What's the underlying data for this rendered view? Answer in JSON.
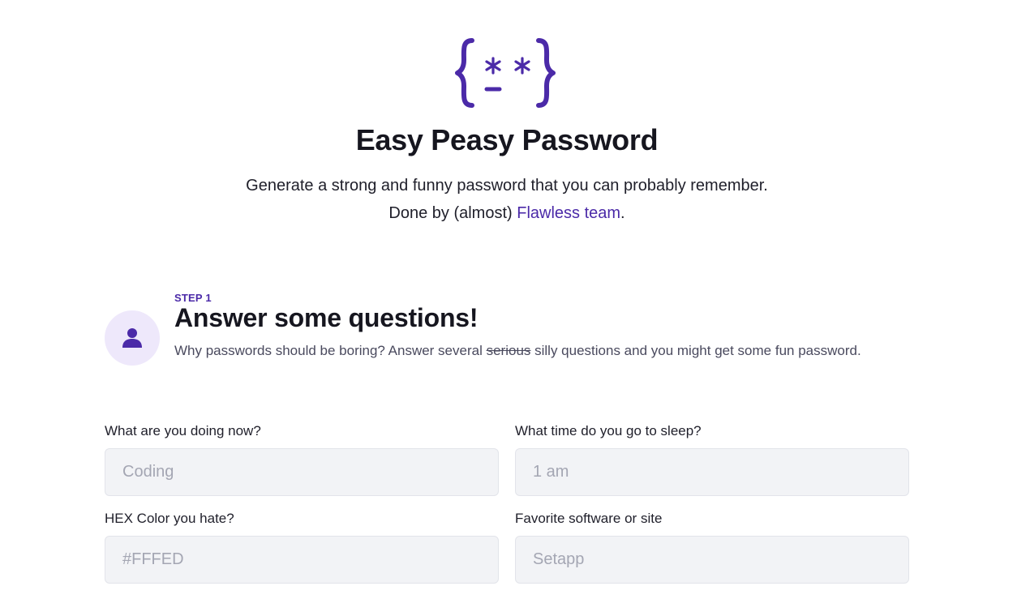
{
  "header": {
    "logo_icon": "curly-braces-face-logo",
    "title": "Easy Peasy Password",
    "subtitle_text": "Generate a strong and funny password that you can probably remember. Done by (almost) ",
    "subtitle_link": "Flawless team",
    "subtitle_end": "."
  },
  "step": {
    "label": "STEP 1",
    "title": "Answer some questions!",
    "desc_before": "Why passwords should be boring? Answer several ",
    "desc_strike": "serious",
    "desc_after": " silly questions and you might get some fun password.",
    "icon": "user-icon"
  },
  "form": {
    "fields": [
      {
        "label": "What are you doing now?",
        "placeholder": "Coding",
        "value": ""
      },
      {
        "label": "What time do you go to sleep?",
        "placeholder": "1 am",
        "value": ""
      },
      {
        "label": "HEX Color you hate?",
        "placeholder": "#FFFED",
        "value": ""
      },
      {
        "label": "Favorite software or site",
        "placeholder": "Setapp",
        "value": ""
      }
    ]
  },
  "colors": {
    "accent": "#4b2aa8",
    "avatar_bg": "#eee8fb",
    "input_bg": "#f2f3f6"
  }
}
